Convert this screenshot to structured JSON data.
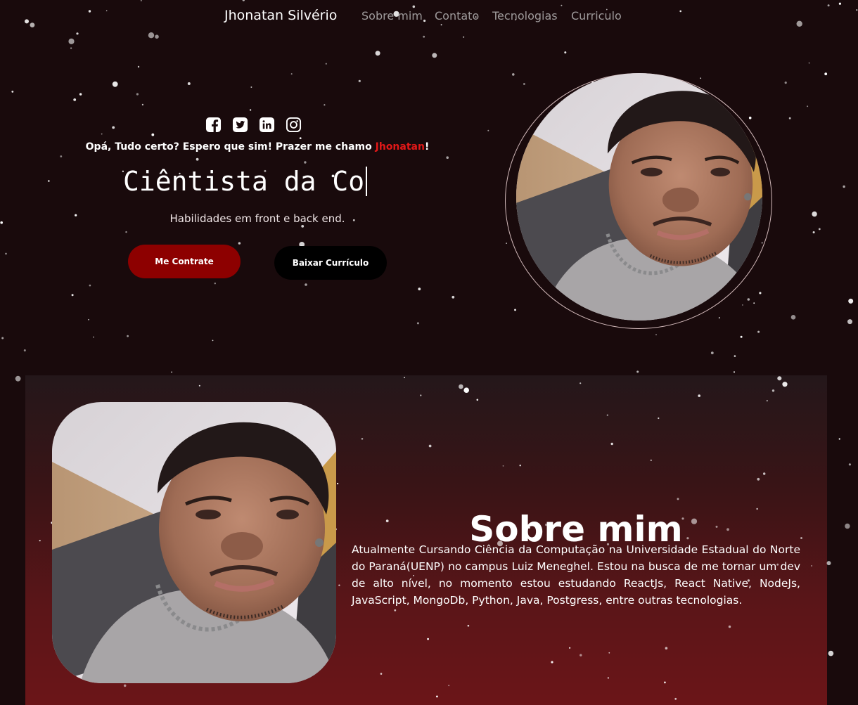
{
  "nav": {
    "brand": "Jhonatan Silvério",
    "links": [
      "Sobre mim",
      "Contato",
      "Tecnologias",
      "Curriculo"
    ]
  },
  "social": [
    "facebook-icon",
    "twitter-icon",
    "linkedin-icon",
    "instagram-icon"
  ],
  "hero": {
    "greeting_prefix": "Opá, Tudo certo? Espero que sim! Prazer me chamo ",
    "greeting_name": "Jhonatan",
    "greeting_suffix": "!",
    "typed_text": "Ciêntista da Co",
    "subtitle": "Habilidades em front e back end.",
    "hire_button": "Me Contrate",
    "resume_button": "Baixar Currículo"
  },
  "about": {
    "title": "Sobre mim",
    "text": "Atualmente Cursando Ciência da Computação na Universidade Estadual do Norte do Paraná(UENP) no campus Luiz Meneghel. Estou na busca de me tornar um dev de alto nível, no momento estou estudando ReactJs, React Native, NodeJs, JavaScript, MongoDb, Python, Java, Postgress, entre outras tecnologias."
  },
  "colors": {
    "background": "#190a0c",
    "accent_red": "#8d0000",
    "highlight": "#e21818",
    "nav_link": "#9e9a9b"
  }
}
